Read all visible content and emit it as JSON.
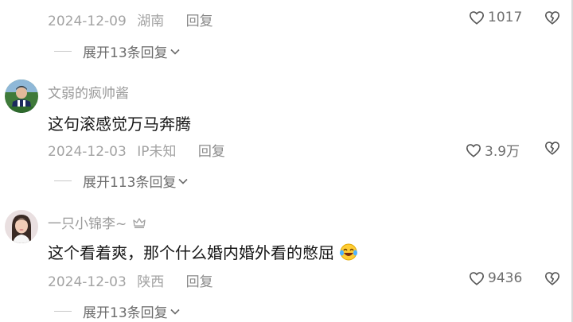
{
  "comments": [
    {
      "date": "2024-12-09",
      "location": "湖南",
      "reply_label": "回复",
      "likes": "1017",
      "expand_label": "展开13条回复"
    },
    {
      "username": "文弱的疯帅酱",
      "text": "这句滚感觉万马奔腾",
      "date": "2024-12-03",
      "location": "IP未知",
      "reply_label": "回复",
      "likes": "3.9万",
      "expand_label": "展开113条回复"
    },
    {
      "username": "一只小锦李~",
      "text": "这个看着爽，那个什么婚内婚外看的憋屈",
      "date": "2024-12-03",
      "location": "陕西",
      "reply_label": "回复",
      "likes": "9436",
      "expand_label": "展开13条回复"
    }
  ],
  "icons": {
    "like": "heart-outline-icon",
    "dislike": "broken-heart-outline-icon",
    "expand": "chevron-down-icon",
    "crown": "crown-icon",
    "emoji": "laughing-tears-emoji"
  }
}
